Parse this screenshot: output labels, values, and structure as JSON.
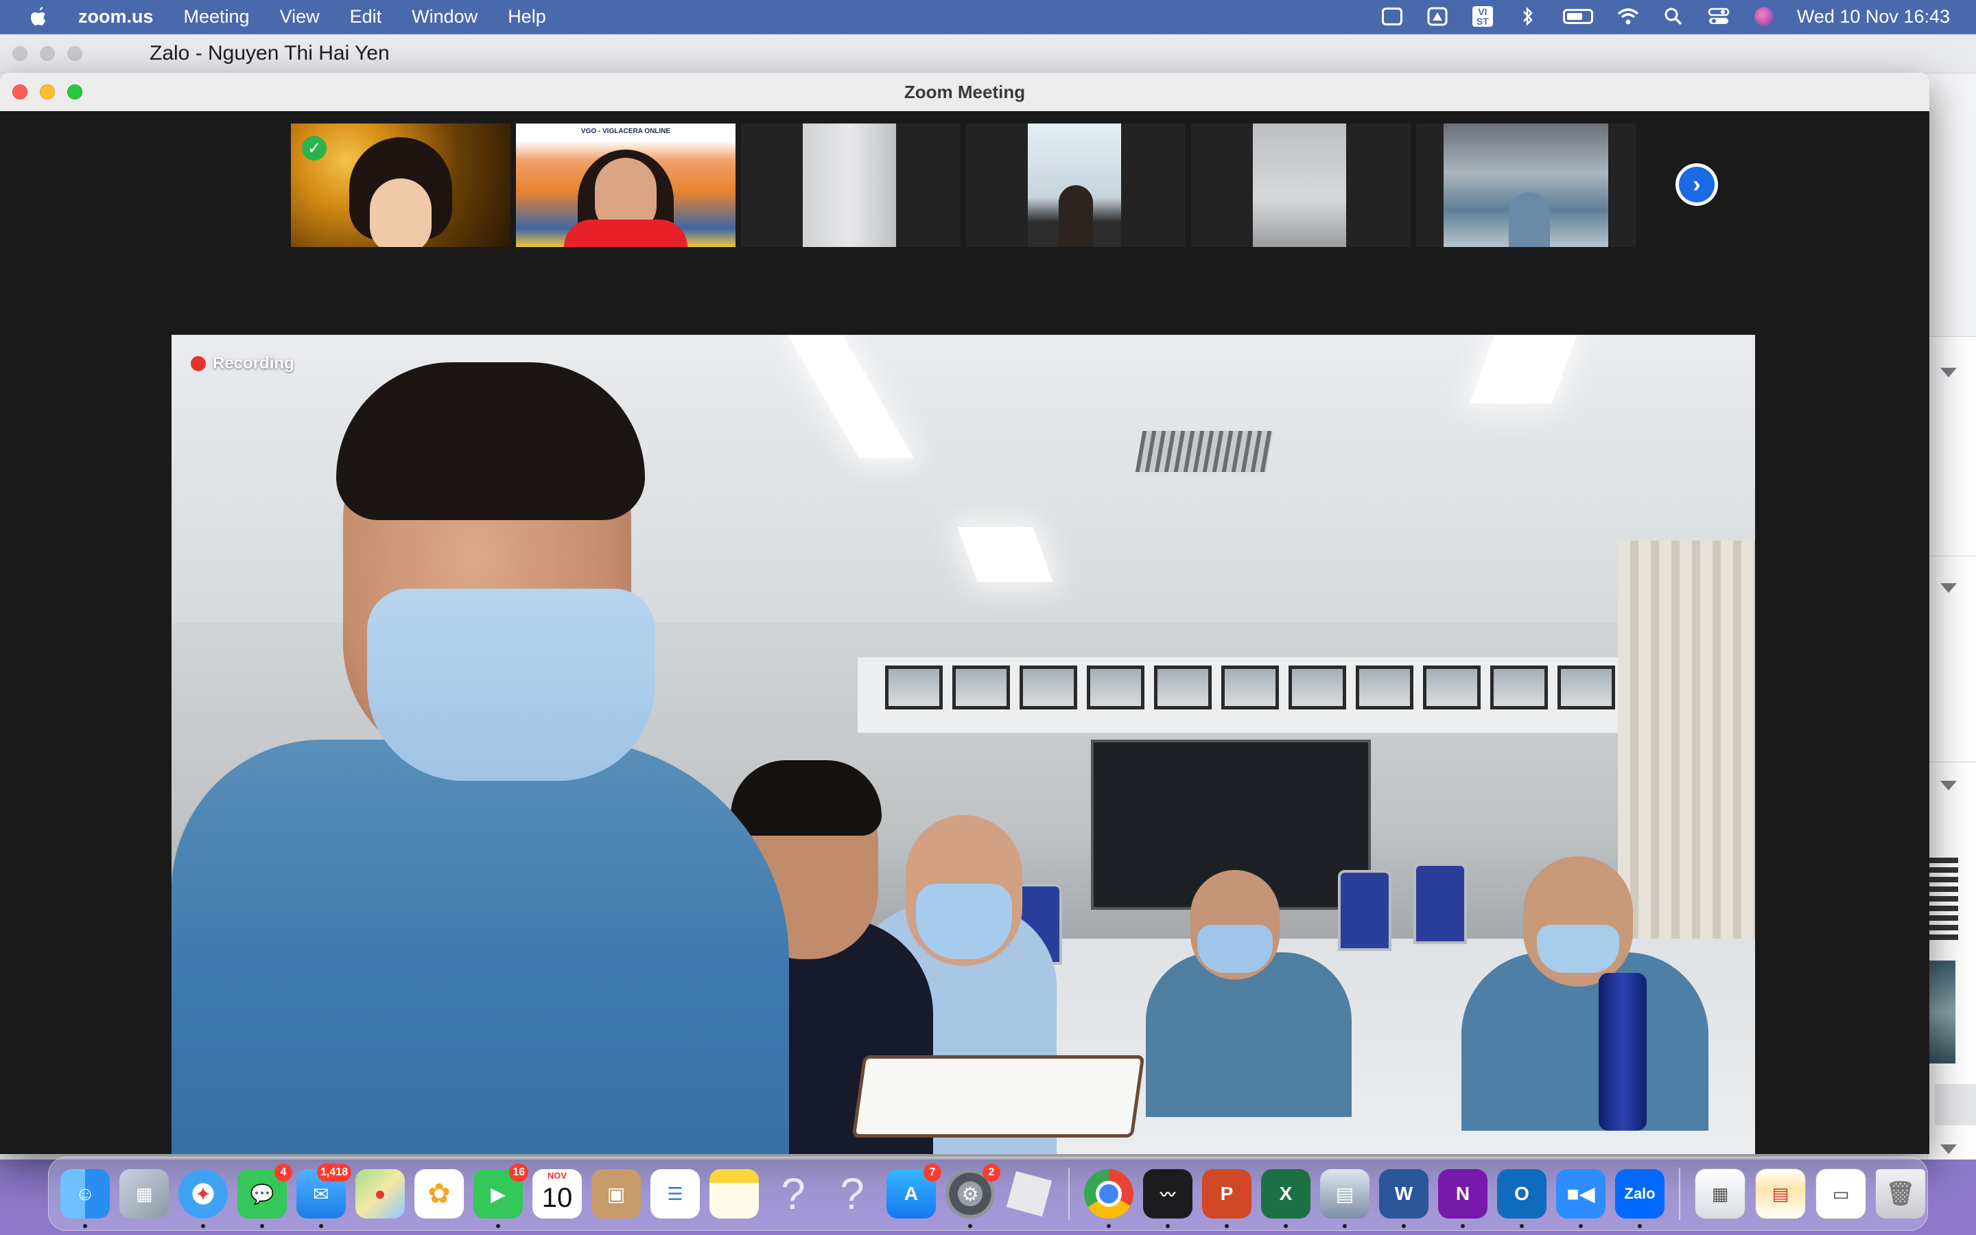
{
  "menubar": {
    "app_name": "zoom.us",
    "menus": [
      "Meeting",
      "View",
      "Edit",
      "Window",
      "Help"
    ],
    "status_icons": [
      "zoom-status-icon",
      "drive-icon",
      "input-source-icon",
      "bluetooth-icon",
      "battery-icon",
      "wifi-icon",
      "spotlight-icon",
      "control-center-icon",
      "siri-icon"
    ],
    "input_source_label": "VI ST",
    "clock": "Wed 10 Nov  16:43"
  },
  "zalo": {
    "title": "Zalo - Nguyen Thi Hai Yen"
  },
  "zoom": {
    "window_title": "Zoom Meeting",
    "recording_label": "Recording",
    "thumbnail_banner": "VGO - VIGLACERA ONLINE",
    "thumbnails": [
      {
        "kind": "participant-video",
        "selected": true
      },
      {
        "kind": "participant-video"
      },
      {
        "kind": "participant-video"
      },
      {
        "kind": "participant-video"
      },
      {
        "kind": "participant-video"
      },
      {
        "kind": "participant-video"
      }
    ],
    "next_page_icon": "chevron-right-icon"
  },
  "colors": {
    "zoom_blue": "#1a6ae6",
    "recording_red": "#e5322d",
    "badge_red": "#ff3b30",
    "selected_check_green": "#2bb24c"
  },
  "dock": {
    "apps": [
      {
        "name": "finder",
        "badge": ""
      },
      {
        "name": "launchpad",
        "badge": ""
      },
      {
        "name": "safari",
        "badge": ""
      },
      {
        "name": "messages",
        "badge": "4"
      },
      {
        "name": "mail",
        "badge": "1,418"
      },
      {
        "name": "maps",
        "badge": ""
      },
      {
        "name": "photos",
        "badge": ""
      },
      {
        "name": "facetime",
        "badge": "16"
      },
      {
        "name": "calendar",
        "badge": "",
        "month": "NOV",
        "day": "10"
      },
      {
        "name": "contacts",
        "badge": ""
      },
      {
        "name": "reminders",
        "badge": ""
      },
      {
        "name": "notes",
        "badge": ""
      },
      {
        "name": "unknown-app-1",
        "badge": ""
      },
      {
        "name": "unknown-app-2",
        "badge": ""
      },
      {
        "name": "app-store",
        "badge": "7"
      },
      {
        "name": "system-preferences",
        "badge": "2"
      },
      {
        "name": "roblox",
        "badge": ""
      },
      {
        "name": "chrome",
        "badge": ""
      },
      {
        "name": "stocks",
        "badge": ""
      },
      {
        "name": "powerpoint",
        "badge": "",
        "letter": "P"
      },
      {
        "name": "excel",
        "badge": "",
        "letter": "X"
      },
      {
        "name": "preview",
        "badge": ""
      },
      {
        "name": "word",
        "badge": "",
        "letter": "W"
      },
      {
        "name": "onenote",
        "badge": "",
        "letter": "N"
      },
      {
        "name": "outlook",
        "badge": "",
        "letter": "O"
      },
      {
        "name": "zoom",
        "badge": ""
      },
      {
        "name": "zalo",
        "badge": "",
        "letter": "Zalo"
      }
    ],
    "right_items": [
      "document-stack-1",
      "document-stack-2",
      "document-stack-3",
      "trash"
    ]
  }
}
